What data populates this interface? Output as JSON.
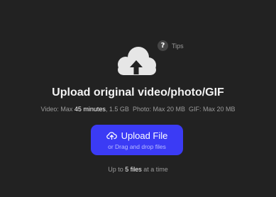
{
  "uploader": {
    "icon": "cloud-upload-icon",
    "tips": {
      "icon": "question-icon",
      "icon_glyph": "?",
      "label": "Tips"
    },
    "title": "Upload original video/photo/GIF",
    "limits": {
      "video_prefix": "Video: Max",
      "video_duration": "45 minutes",
      "video_size": ", 1.5 GB",
      "photo": "Photo: Max 20 MB",
      "gif": "GIF: Max 20 MB"
    },
    "button": {
      "icon": "cloud-upload-icon",
      "label": "Upload File",
      "sublabel": "or Drag and drop files",
      "color": "#3b3bf5"
    },
    "files_note": {
      "prefix": "Up to",
      "count": "5 files",
      "suffix": "at a time"
    }
  },
  "colors": {
    "background": "#222222",
    "accent": "#3b3bf5",
    "icon": "#e6e6e6"
  }
}
